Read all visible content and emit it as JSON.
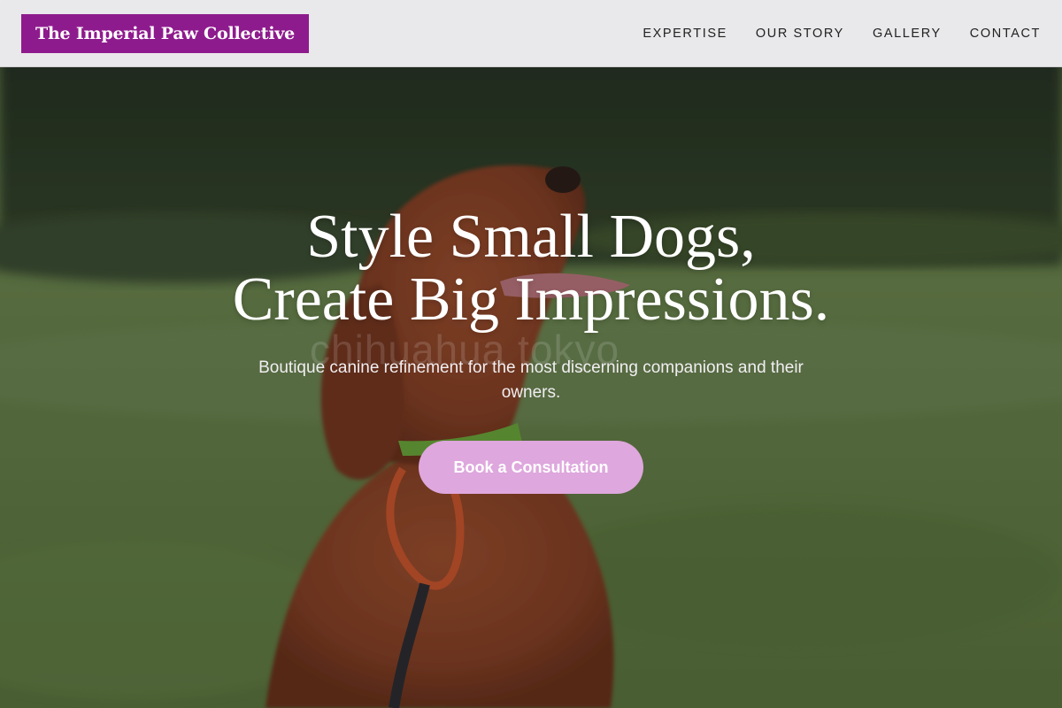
{
  "header": {
    "brand": "The Imperial Paw Collective",
    "nav": [
      {
        "label": "EXPERTISE"
      },
      {
        "label": "OUR STORY"
      },
      {
        "label": "GALLERY"
      },
      {
        "label": "CONTACT"
      }
    ]
  },
  "hero": {
    "title_line1": "Style Small Dogs,",
    "title_line2": "Create Big Impressions.",
    "subtitle": "Boutique canine refinement for the most discerning companions and their owners.",
    "cta_label": "Book a Consultation",
    "image_watermark": "chihuahua tokyo"
  },
  "colors": {
    "brand_purple": "#8e1b8d",
    "cta_pink": "#dea7dd",
    "header_bg": "#f0eef2"
  },
  "icons": {
    "hero_photo": "dog-photo"
  }
}
